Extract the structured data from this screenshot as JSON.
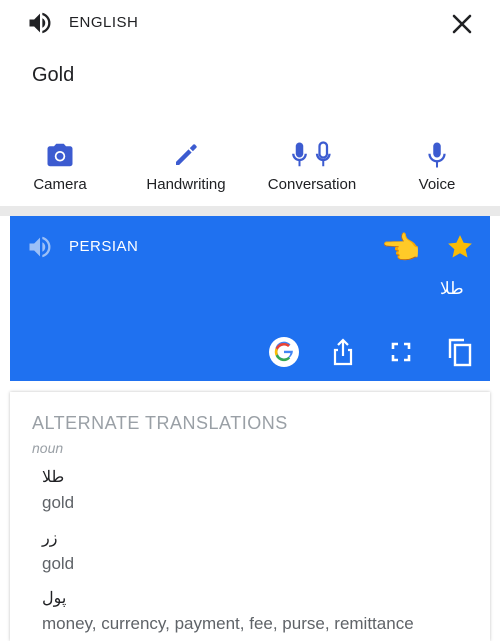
{
  "source": {
    "language": "ENGLISH",
    "text": "Gold"
  },
  "icons": {
    "speaker": "speaker-icon",
    "close": "close-icon",
    "camera": "camera-icon",
    "handwriting": "pen-icon",
    "conversation": "double-mic-icon",
    "voice": "mic-icon",
    "star": "star-icon",
    "google": "google-icon",
    "share": "share-icon",
    "fullscreen": "fullscreen-icon",
    "copy": "copy-icon"
  },
  "modes": [
    {
      "label": "Camera"
    },
    {
      "label": "Handwriting"
    },
    {
      "label": "Conversation"
    },
    {
      "label": "Voice"
    }
  ],
  "translation": {
    "language": "PERSIAN",
    "text": "طلا",
    "annotation_emoji": "👉",
    "starred": true
  },
  "alternates": {
    "title": "ALTERNATE TRANSLATIONS",
    "part_of_speech": "noun",
    "items": [
      {
        "word": "طلا",
        "meaning": "gold"
      },
      {
        "word": "زر",
        "meaning": "gold"
      },
      {
        "word": "پول",
        "meaning": "money, currency, payment, fee, purse, remittance"
      }
    ]
  },
  "colors": {
    "accent_blue": "#1f71f0",
    "icon_blue": "#3c5bd0",
    "star_yellow": "#fbbc05"
  }
}
